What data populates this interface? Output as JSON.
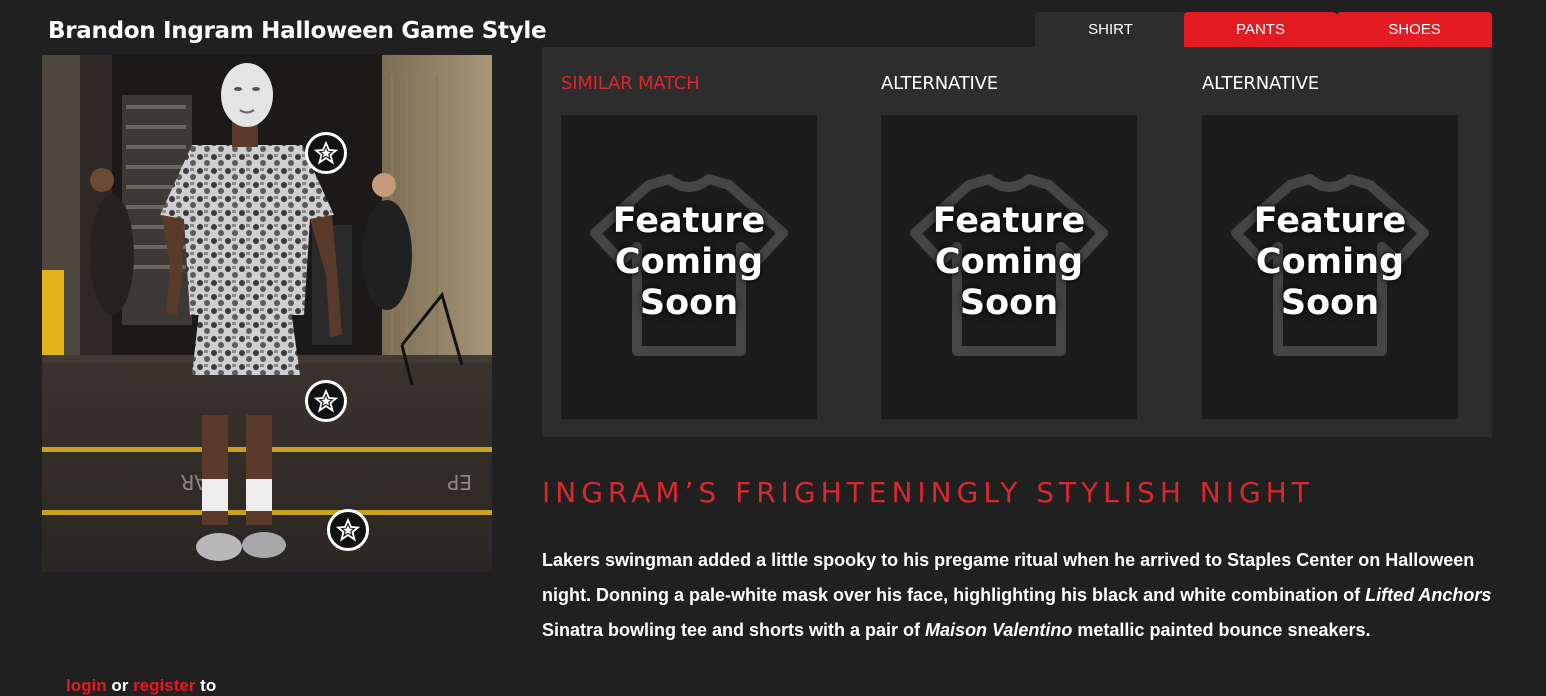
{
  "page": {
    "title": "Brandon Ingram Halloween Game Style"
  },
  "tabs": [
    {
      "label": "SHIRT",
      "active": true
    },
    {
      "label": "PANTS",
      "active": false
    },
    {
      "label": "SHOES",
      "active": false
    }
  ],
  "matches": [
    {
      "label": "SIMILAR MATCH",
      "placeholder": [
        "Feature",
        "Coming",
        "Soon"
      ]
    },
    {
      "label": "ALTERNATIVE",
      "placeholder": [
        "Feature",
        "Coming",
        "Soon"
      ]
    },
    {
      "label": "ALTERNATIVE",
      "placeholder": [
        "Feature",
        "Coming",
        "Soon"
      ]
    }
  ],
  "article": {
    "headline": "INGRAM’S FRIGHTENINGLY STYLISH NIGHT",
    "p1": "Lakers swingman added a little spooky to his pregame ritual when he arrived to Staples Center on Halloween night. Donning a pale-white mask over his face, highlighting his black and white combination of ",
    "brand1": "Lifted Anchors",
    "p2": " Sinatra bowling tee and shorts with a pair of ",
    "brand2": "Maison Valentino",
    "p3": " metallic painted bounce sneakers."
  },
  "auth": {
    "login": "login",
    "or": " or ",
    "register": "register",
    "suffix": " to"
  },
  "icons": {
    "hotspot": "star-logo-icon",
    "placeholder": "tshirt-icon"
  },
  "colors": {
    "accent": "#e31b23",
    "background": "#202020",
    "panel": "#2d2d2d"
  }
}
